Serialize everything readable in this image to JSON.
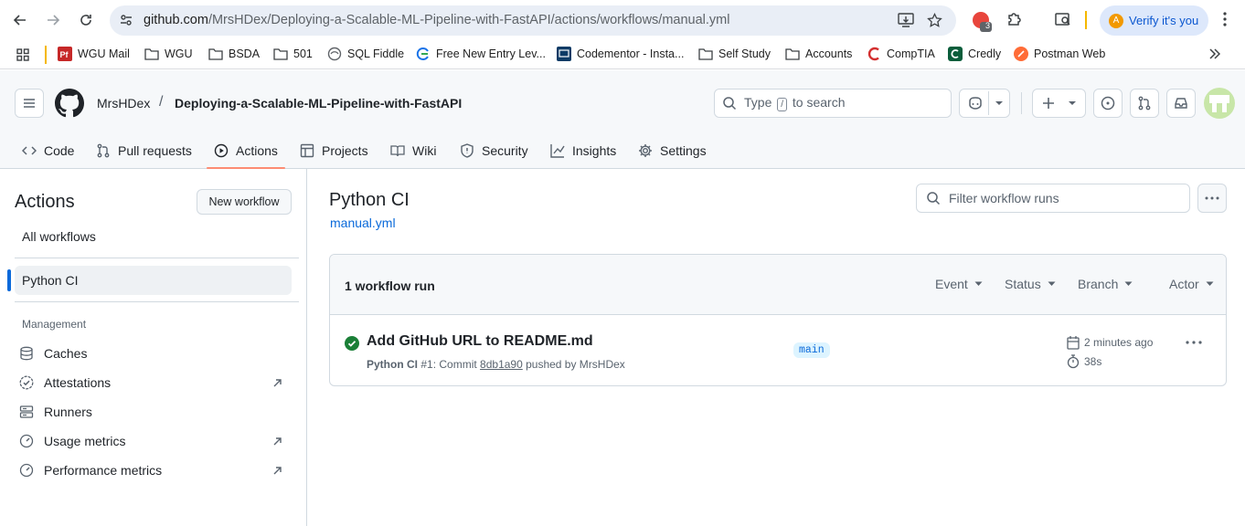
{
  "browser": {
    "url_host": "github.com",
    "url_path": "/MrsHDex/Deploying-a-Scalable-ML-Pipeline-with-FastAPI/actions/workflows/manual.yml",
    "ext_badge": "3",
    "verify_label": "Verify it's you",
    "avatar_letter": "A"
  },
  "bookmarks": [
    {
      "label": "WGU Mail",
      "icon": "pf-icon"
    },
    {
      "label": "WGU",
      "icon": "folder-icon"
    },
    {
      "label": "BSDA",
      "icon": "folder-icon"
    },
    {
      "label": "501",
      "icon": "folder-icon"
    },
    {
      "label": "SQL Fiddle",
      "icon": "sql-fiddle-icon"
    },
    {
      "label": "Free New Entry Lev...",
      "icon": "entry-icon"
    },
    {
      "label": "Codementor - Insta...",
      "icon": "codementor-icon"
    },
    {
      "label": "Self Study",
      "icon": "folder-icon"
    },
    {
      "label": "Accounts",
      "icon": "folder-icon"
    },
    {
      "label": "CompTIA",
      "icon": "comptia-icon"
    },
    {
      "label": "Credly",
      "icon": "credly-icon"
    },
    {
      "label": "Postman Web",
      "icon": "postman-icon"
    }
  ],
  "header": {
    "owner": "MrsHDex",
    "separator": "/",
    "repo": "Deploying-a-Scalable-ML-Pipeline-with-FastAPI",
    "search_prefix": "Type",
    "search_key": "/",
    "search_suffix": "to search"
  },
  "tabs": [
    {
      "label": "Code",
      "icon": "code-icon"
    },
    {
      "label": "Pull requests",
      "icon": "pull-request-icon"
    },
    {
      "label": "Actions",
      "icon": "play-icon",
      "active": true
    },
    {
      "label": "Projects",
      "icon": "table-icon"
    },
    {
      "label": "Wiki",
      "icon": "book-icon"
    },
    {
      "label": "Security",
      "icon": "shield-icon"
    },
    {
      "label": "Insights",
      "icon": "graph-icon"
    },
    {
      "label": "Settings",
      "icon": "gear-icon"
    }
  ],
  "sidebar": {
    "title": "Actions",
    "new_workflow": "New workflow",
    "all_workflows": "All workflows",
    "selected_workflow": "Python CI",
    "management_heading": "Management",
    "management_items": [
      {
        "label": "Caches",
        "icon": "cache-icon",
        "external": false
      },
      {
        "label": "Attestations",
        "icon": "verified-icon",
        "external": true
      },
      {
        "label": "Runners",
        "icon": "server-icon",
        "external": false
      },
      {
        "label": "Usage metrics",
        "icon": "meter-icon",
        "external": true
      },
      {
        "label": "Performance metrics",
        "icon": "meter-icon",
        "external": true
      }
    ]
  },
  "main": {
    "title": "Python CI",
    "file": "manual.yml",
    "filter_placeholder": "Filter workflow runs",
    "run_count": "1 workflow run",
    "filters": [
      "Event",
      "Status",
      "Branch",
      "Actor"
    ],
    "run": {
      "title": "Add GitHub URL to README.md",
      "workflow": "Python CI",
      "number": "#1",
      "sub_middle": ": Commit ",
      "sha": "8db1a90",
      "sub_end": " pushed by MrsHDex",
      "branch": "main",
      "time": "2 minutes ago",
      "duration": "38s",
      "status": "success",
      "status_color": "#1a7f37"
    }
  }
}
